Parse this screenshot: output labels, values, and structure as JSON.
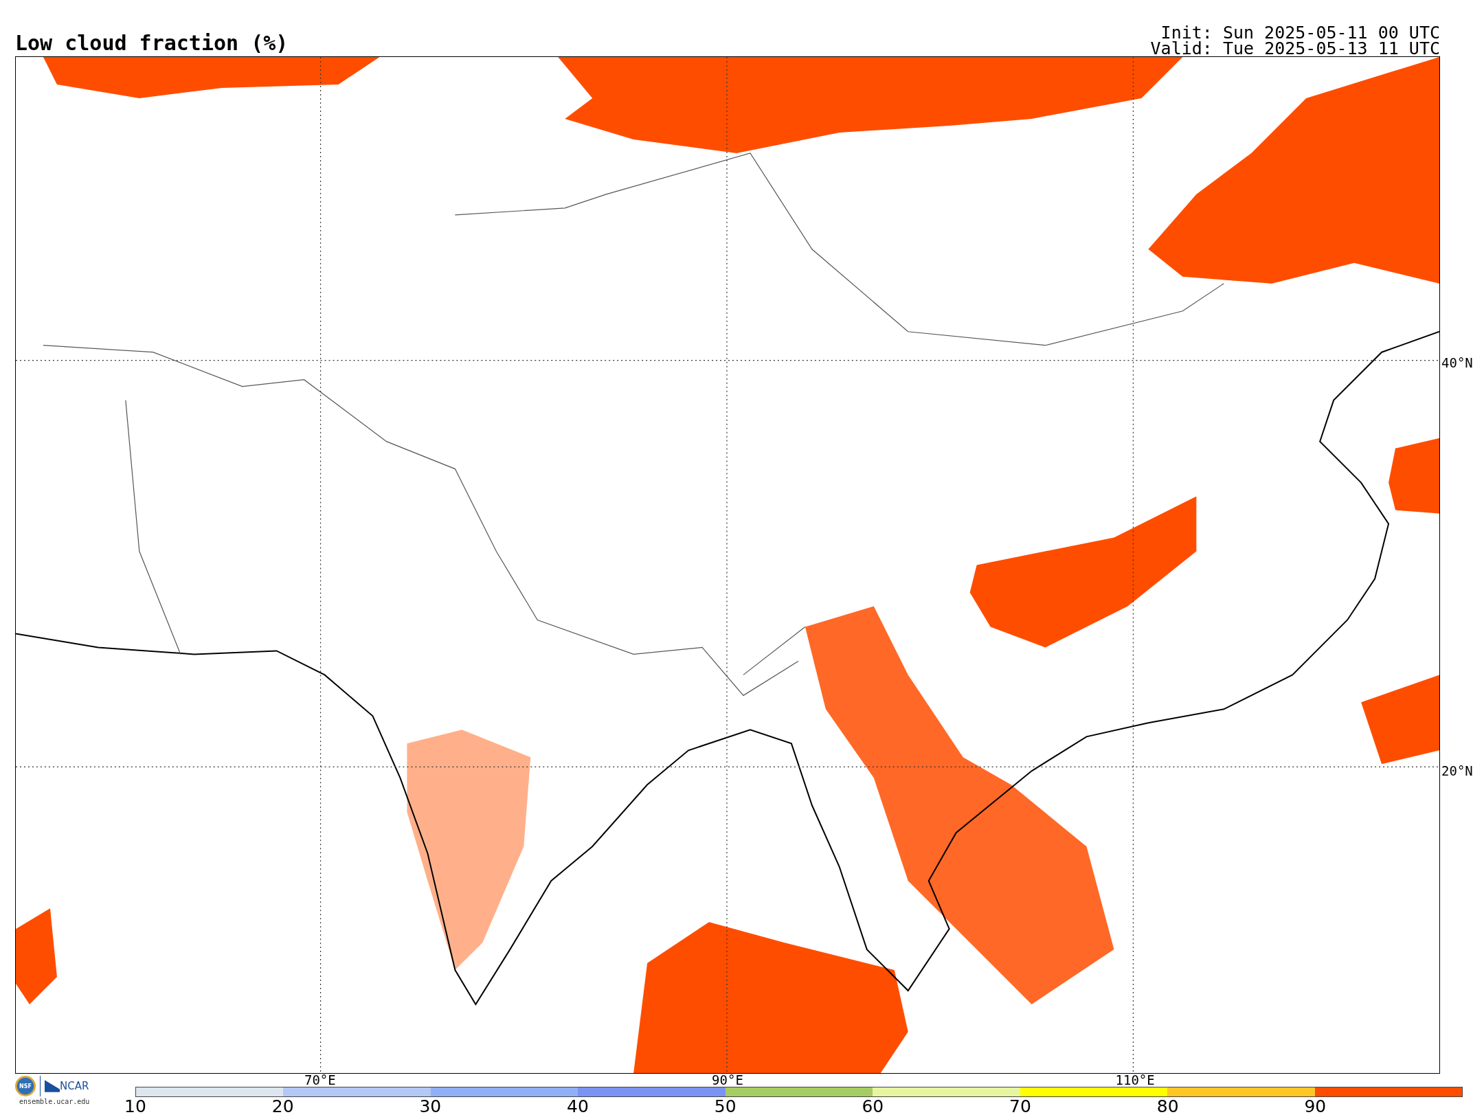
{
  "title": "Low cloud fraction (%)",
  "init": "Init: Sun 2025-05-11 00 UTC",
  "valid": "Valid: Tue 2025-05-13 11 UTC",
  "map": {
    "lat_labels": [
      "40°N",
      "20°N"
    ],
    "lon_labels": [
      "70°E",
      "90°E",
      "110°E"
    ]
  },
  "logo": {
    "nsf": "NSF",
    "ncar": "NCAR",
    "site": "ensemble.ucar.edu"
  },
  "colorbar": {
    "bins": [
      {
        "color": "#dde6ee"
      },
      {
        "color": "#b3c8f5"
      },
      {
        "color": "#8fb0f5"
      },
      {
        "color": "#7b93f2"
      },
      {
        "color": "#a6cc64"
      },
      {
        "color": "#e8f5a0"
      },
      {
        "color": "#ffff00"
      },
      {
        "color": "#ffc726"
      },
      {
        "color": "#ff4d00"
      }
    ],
    "ticks": [
      "10",
      "20",
      "30",
      "40",
      "50",
      "60",
      "70",
      "80",
      "90"
    ]
  }
}
